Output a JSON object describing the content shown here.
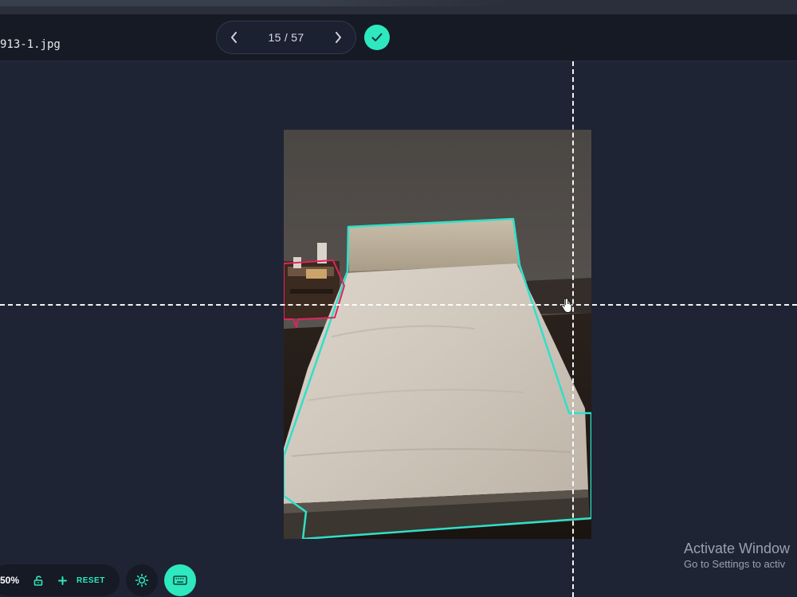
{
  "file": {
    "name": "913-1.jpg"
  },
  "pager": {
    "counter": "15 / 57"
  },
  "zoom": {
    "value": "50%",
    "reset_label": "RESET"
  },
  "watermark": {
    "title": "Activate Window",
    "subtitle": "Go to Settings to activ"
  },
  "colors": {
    "accent": "#2ee8bf",
    "bed_polygon": "#2fe0c8",
    "nightstand_polygon": "#e0245e",
    "background": "#1e2433",
    "topbar": "#151a25"
  },
  "icons": {
    "prev": "chevron-left-icon",
    "next": "chevron-right-icon",
    "confirm": "check-icon",
    "lock": "unlock-icon",
    "add": "plus-icon",
    "brightness": "sun-icon",
    "keyboard": "keyboard-icon",
    "cursor": "hand-cursor-icon"
  }
}
